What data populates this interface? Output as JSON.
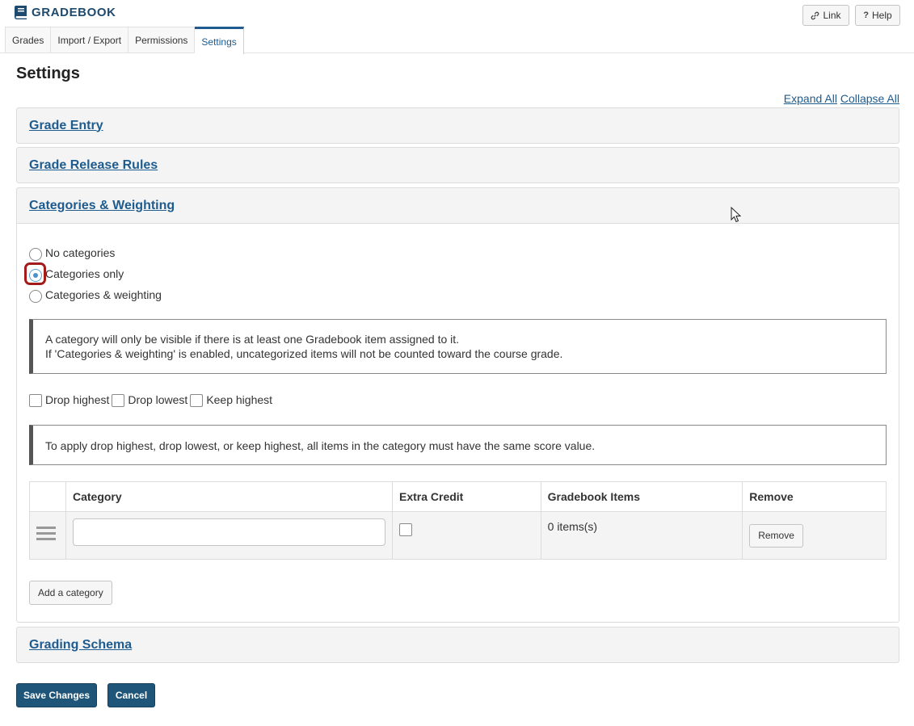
{
  "header": {
    "title": "GRADEBOOK",
    "link_label": "Link",
    "help_label": "Help",
    "help_glyph": "?"
  },
  "tabs": [
    {
      "label": "Grades"
    },
    {
      "label": "Import / Export"
    },
    {
      "label": "Permissions"
    },
    {
      "label": "Settings",
      "active": true
    }
  ],
  "page": {
    "title": "Settings",
    "expand_all": "Expand All",
    "collapse_all": "Collapse All"
  },
  "sections": {
    "grade_entry": "Grade Entry",
    "grade_release_rules": "Grade Release Rules",
    "categories_weighting": "Categories & Weighting",
    "grading_schema": "Grading Schema"
  },
  "categories": {
    "options": [
      {
        "label": "No categories",
        "checked": false
      },
      {
        "label": "Categories only",
        "checked": true
      },
      {
        "label": "Categories & weighting",
        "checked": false
      }
    ],
    "note_line1": "A category will only be visible if there is at least one Gradebook item assigned to it.",
    "note_line2": "If 'Categories & weighting' is enabled, uncategorized items will not be counted toward the course grade.",
    "drop_highest": "Drop highest",
    "drop_lowest": "Drop lowest",
    "keep_highest": "Keep highest",
    "drop_note": "To apply drop highest, drop lowest, or keep highest, all items in the category must have the same score value.",
    "table": {
      "headers": [
        "",
        "Category",
        "Extra Credit",
        "Gradebook Items",
        "Remove"
      ],
      "rows": [
        {
          "category": "",
          "extra_credit": false,
          "items": "0 items(s)",
          "remove_label": "Remove"
        }
      ]
    },
    "add_label": "Add a category"
  },
  "footer": {
    "save_label": "Save Changes",
    "cancel_label": "Cancel"
  },
  "colors": {
    "brand": "#1e4a6e",
    "link": "#1e5b8e",
    "primary_button": "#1f5579",
    "highlight": "#a31b1b"
  }
}
